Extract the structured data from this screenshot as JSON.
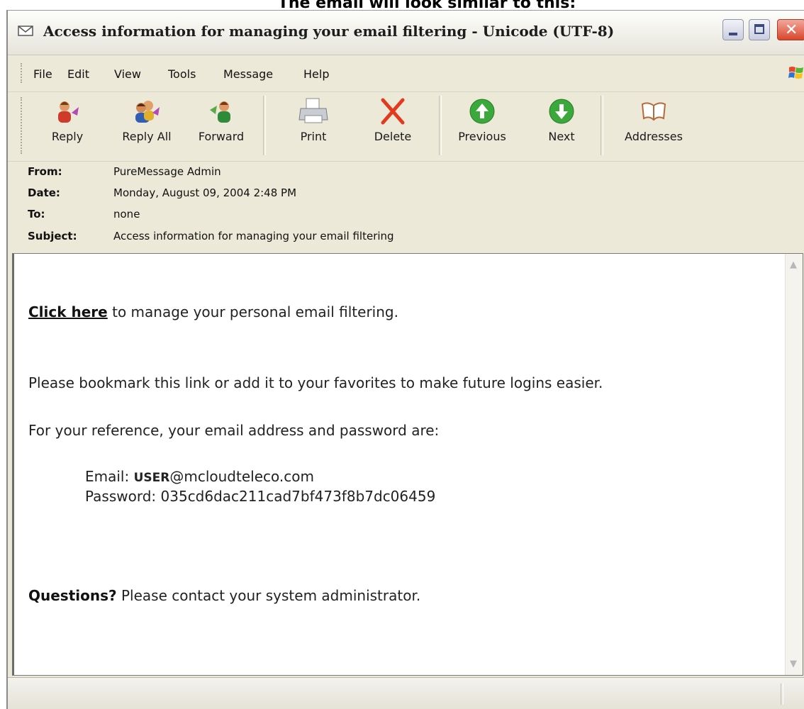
{
  "caption": "The email will look similar to this:",
  "window": {
    "title": "Access information for managing your email filtering - Unicode (UTF-8)"
  },
  "menu": [
    {
      "label": "File"
    },
    {
      "label": "Edit"
    },
    {
      "label": "View"
    },
    {
      "label": "Tools"
    },
    {
      "label": "Message"
    },
    {
      "label": "Help"
    }
  ],
  "toolbar": {
    "reply": "Reply",
    "reply_all": "Reply All",
    "forward": "Forward",
    "print": "Print",
    "delete": "Delete",
    "previous": "Previous",
    "next": "Next",
    "addresses": "Addresses"
  },
  "header": {
    "from_label": "From:",
    "from_value": "PureMessage Admin",
    "date_label": "Date:",
    "date_value": "Monday, August 09, 2004 2:48 PM",
    "to_label": "To:",
    "to_value": "none",
    "subject_label": "Subject:",
    "subject_value": "Access information for managing your email filtering"
  },
  "message": {
    "link_text": "Click here",
    "link_rest": " to manage your personal email filtering.",
    "bookmark": "Please bookmark this link or add it to your favorites to make future logins easier.",
    "reference": "For your reference, your email address and password are:",
    "email_label": "Email: ",
    "email_user": "USER",
    "email_domain": "@mcloudteleco.com",
    "password_label": "Password: ",
    "password_value": "035cd6dac211cad7bf473f8b7dc06459",
    "questions_bold": "Questions?",
    "questions_rest": " Please contact your system administrator."
  },
  "colors": {
    "window_bg": "#ece9d8",
    "close_button": "#d9462b",
    "nav_green": "#3aa83a",
    "delete_red": "#e23a1e"
  }
}
